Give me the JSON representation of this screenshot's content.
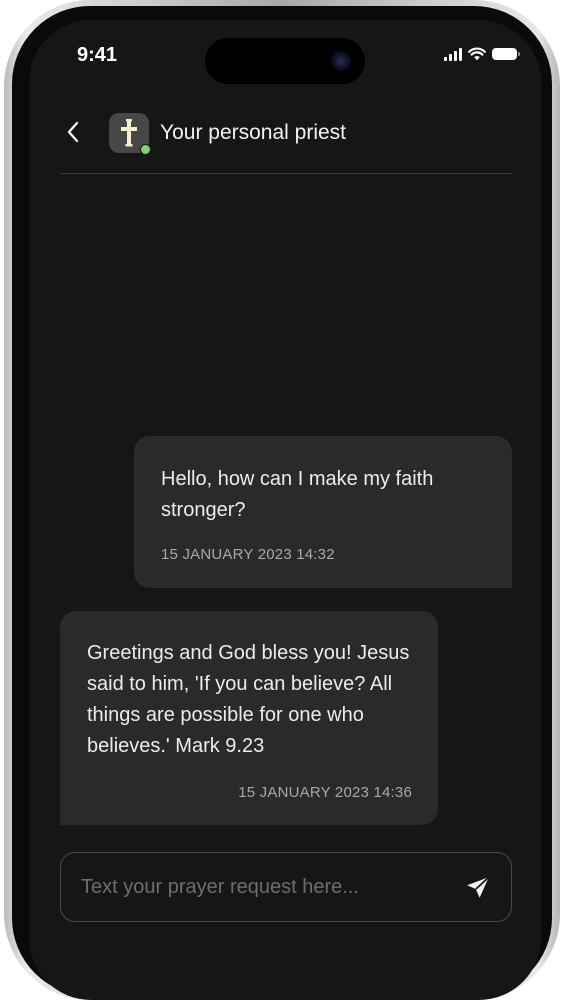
{
  "status_bar": {
    "time": "9:41"
  },
  "header": {
    "title": "Your personal priest",
    "avatar_icon": "cross-icon",
    "online_color": "#7bd66e"
  },
  "messages": [
    {
      "sender": "user",
      "text": "Hello, how can I make my faith stronger?",
      "timestamp": "15 JANUARY 2023 14:32"
    },
    {
      "sender": "priest",
      "text": "Greetings and God bless you! Jesus said to him, 'If you can believe? All things are possible for one who believes.' Mark 9.23",
      "timestamp": "15 JANUARY 2023 14:36"
    }
  ],
  "composer": {
    "placeholder": "Text your prayer request here...",
    "value": ""
  },
  "colors": {
    "background": "#161616",
    "bubble": "#2a2a2a",
    "text": "#ececec",
    "muted": "#a8a8a8"
  }
}
